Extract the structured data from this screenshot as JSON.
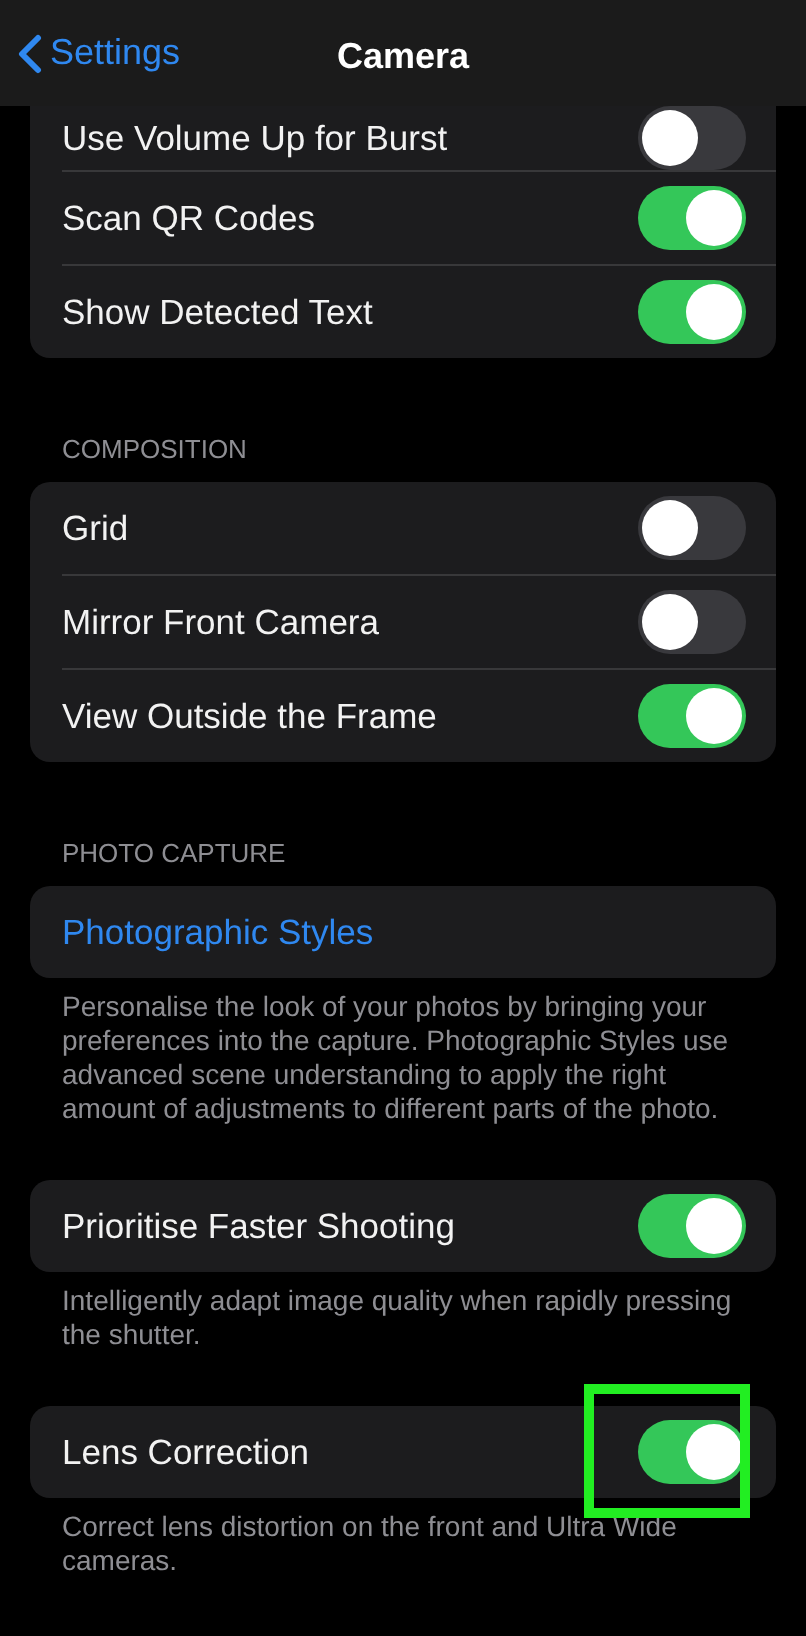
{
  "nav": {
    "back_label": "Settings",
    "title": "Camera"
  },
  "sections": [
    {
      "rows": [
        {
          "kind": "toggle",
          "label": "Use Volume Up for Burst",
          "on": false,
          "highlighted": false
        },
        {
          "kind": "toggle",
          "label": "Scan QR Codes",
          "on": true,
          "highlighted": false
        },
        {
          "kind": "toggle",
          "label": "Show Detected Text",
          "on": true,
          "highlighted": false
        }
      ]
    },
    {
      "header": "COMPOSITION",
      "rows": [
        {
          "kind": "toggle",
          "label": "Grid",
          "on": false,
          "highlighted": false
        },
        {
          "kind": "toggle",
          "label": "Mirror Front Camera",
          "on": false,
          "highlighted": false
        },
        {
          "kind": "toggle",
          "label": "View Outside the Frame",
          "on": true,
          "highlighted": false
        }
      ]
    },
    {
      "header": "PHOTO CAPTURE",
      "rows": [
        {
          "kind": "link",
          "label": "Photographic Styles"
        }
      ],
      "footer": "Personalise the look of your photos by bringing your preferences into the capture. Photographic Styles use advanced scene understanding to apply the right amount of adjustments to different parts of the photo."
    },
    {
      "rows": [
        {
          "kind": "toggle",
          "label": "Prioritise Faster Shooting",
          "on": true,
          "highlighted": false
        }
      ],
      "footer": "Intelligently adapt image quality when rapidly pressing the shutter."
    },
    {
      "rows": [
        {
          "kind": "toggle",
          "label": "Lens Correction",
          "on": true,
          "highlighted": true
        }
      ],
      "footer": "Correct lens distortion on the front and Ultra Wide cameras."
    }
  ]
}
